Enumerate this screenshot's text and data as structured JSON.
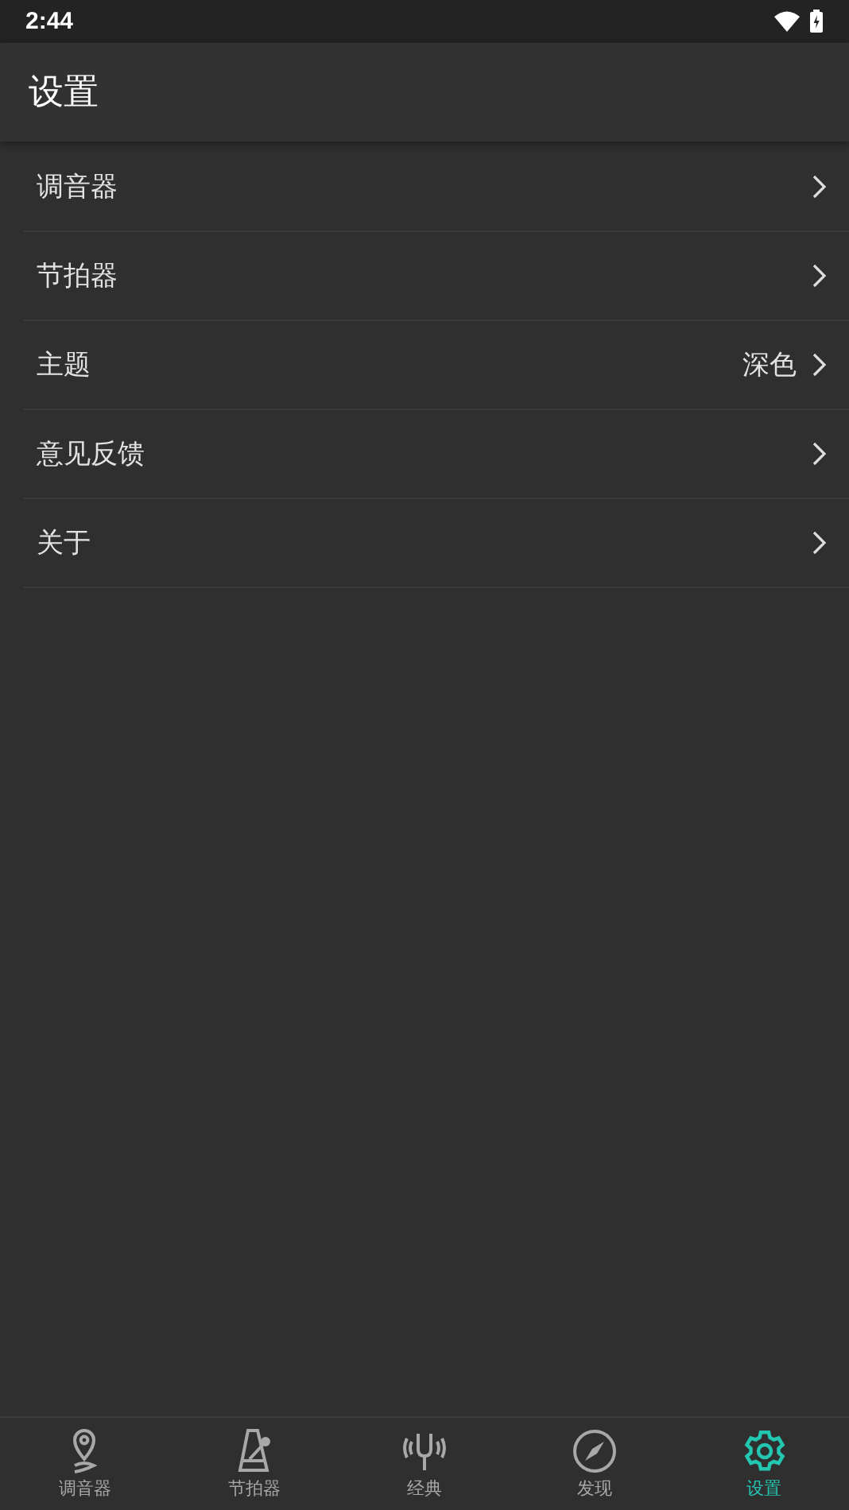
{
  "status_bar": {
    "time": "2:44"
  },
  "app_bar": {
    "title": "设置"
  },
  "settings": [
    {
      "label": "调音器"
    },
    {
      "label": "节拍器"
    },
    {
      "label": "主题",
      "value": "深色"
    },
    {
      "label": "意见反馈"
    },
    {
      "label": "关于"
    }
  ],
  "bottom_nav": [
    {
      "label": "调音器",
      "selected": false
    },
    {
      "label": "节拍器",
      "selected": false
    },
    {
      "label": "经典",
      "selected": false
    },
    {
      "label": "发现",
      "selected": false
    },
    {
      "label": "设置",
      "selected": true
    }
  ]
}
